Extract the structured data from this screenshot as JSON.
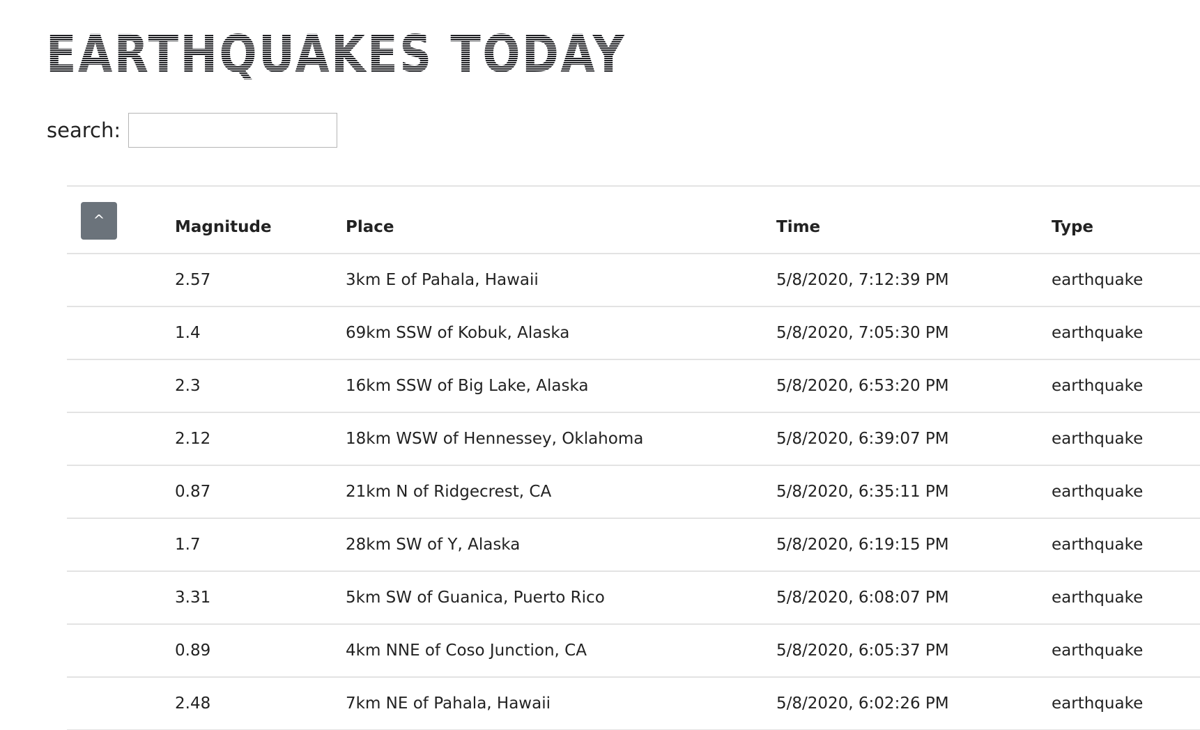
{
  "page": {
    "title": "EARTHQUAKES TODAY"
  },
  "search": {
    "label": "search:",
    "value": "",
    "placeholder": ""
  },
  "table": {
    "sort_button_label": "^",
    "columns": [
      "Magnitude",
      "Place",
      "Time",
      "Type"
    ],
    "rows": [
      {
        "magnitude": "2.57",
        "place": "3km E of Pahala, Hawaii",
        "time": "5/8/2020, 7:12:39 PM",
        "type": "earthquake"
      },
      {
        "magnitude": "1.4",
        "place": "69km SSW of Kobuk, Alaska",
        "time": "5/8/2020, 7:05:30 PM",
        "type": "earthquake"
      },
      {
        "magnitude": "2.3",
        "place": "16km SSW of Big Lake, Alaska",
        "time": "5/8/2020, 6:53:20 PM",
        "type": "earthquake"
      },
      {
        "magnitude": "2.12",
        "place": "18km WSW of Hennessey, Oklahoma",
        "time": "5/8/2020, 6:39:07 PM",
        "type": "earthquake"
      },
      {
        "magnitude": "0.87",
        "place": "21km N of Ridgecrest, CA",
        "time": "5/8/2020, 6:35:11 PM",
        "type": "earthquake"
      },
      {
        "magnitude": "1.7",
        "place": "28km SW of Y, Alaska",
        "time": "5/8/2020, 6:19:15 PM",
        "type": "earthquake"
      },
      {
        "magnitude": "3.31",
        "place": "5km SW of Guanica, Puerto Rico",
        "time": "5/8/2020, 6:08:07 PM",
        "type": "earthquake"
      },
      {
        "magnitude": "0.89",
        "place": "4km NNE of Coso Junction, CA",
        "time": "5/8/2020, 6:05:37 PM",
        "type": "earthquake"
      },
      {
        "magnitude": "2.48",
        "place": "7km NE of Pahala, Hawaii",
        "time": "5/8/2020, 6:02:26 PM",
        "type": "earthquake"
      }
    ]
  },
  "colors": {
    "sort_button_bg": "#6b737b",
    "row_divider": "#e3e3e3",
    "text": "#222222"
  }
}
